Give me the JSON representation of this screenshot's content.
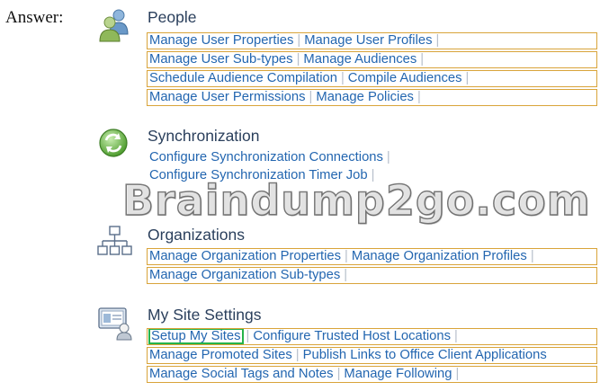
{
  "answer_label": "Answer:",
  "watermark": "Braindump2go.com",
  "people": {
    "title": "People",
    "rows": [
      [
        "Manage User Properties",
        "Manage User Profiles"
      ],
      [
        "Manage User Sub-types",
        "Manage Audiences"
      ],
      [
        "Schedule Audience Compilation",
        "Compile Audiences"
      ],
      [
        "Manage User Permissions",
        "Manage Policies"
      ]
    ]
  },
  "sync": {
    "title": "Synchronization",
    "links": [
      "Configure Synchronization Connections",
      "Configure Synchronization Timer Job"
    ]
  },
  "orgs": {
    "title": "Organizations",
    "rows": [
      [
        "Manage Organization Properties",
        "Manage Organization Profiles"
      ],
      [
        "Manage Organization Sub-types"
      ]
    ]
  },
  "mysite": {
    "title": "My Site Settings",
    "rows": [
      [
        "Setup My Sites",
        "Configure Trusted Host Locations"
      ],
      [
        "Manage Promoted Sites",
        "Publish Links to Office Client Applications"
      ],
      [
        "Manage Social Tags and Notes",
        "Manage Following"
      ]
    ]
  },
  "colors": {
    "link": "#2366b0",
    "row_border": "#d9a43a",
    "highlight_border": "#25b34a",
    "title": "#2a3f5c"
  }
}
